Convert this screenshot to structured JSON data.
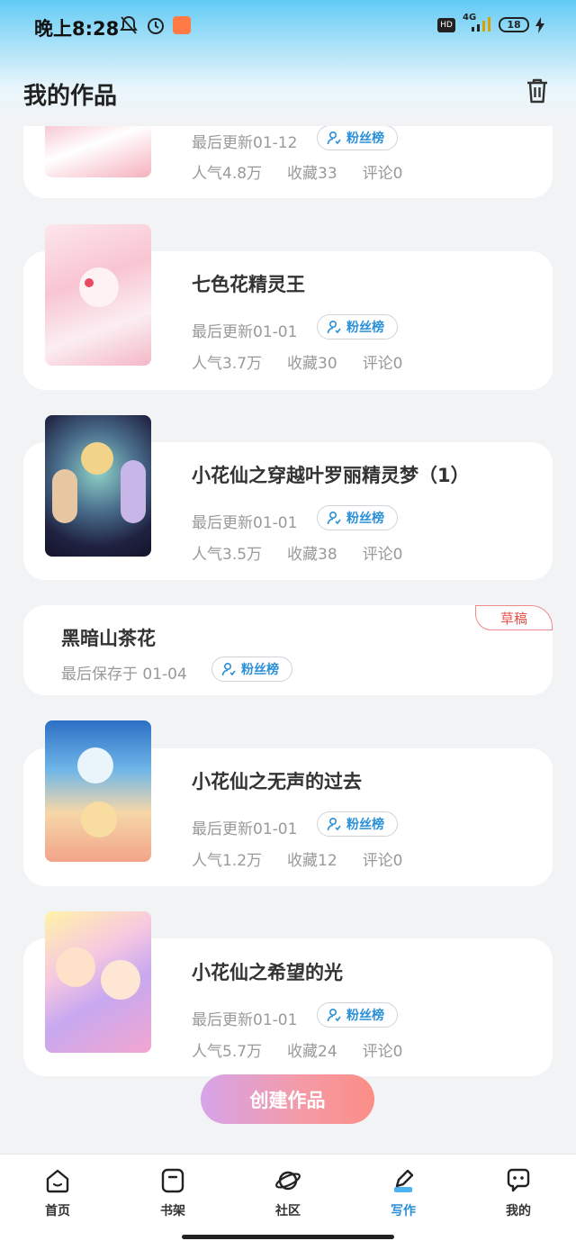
{
  "status_bar": {
    "time": "晚上8:28",
    "battery": "18",
    "network": "4G",
    "hd": "HD"
  },
  "header": {
    "title": "我的作品"
  },
  "works": [
    {
      "title": "",
      "updated": "最后更新01-12",
      "fans": "粉丝榜",
      "popularity": "人气4.8万",
      "favorites": "收藏33",
      "comments": "评论0"
    },
    {
      "title": "七色花精灵王",
      "updated": "最后更新01-01",
      "fans": "粉丝榜",
      "popularity": "人气3.7万",
      "favorites": "收藏30",
      "comments": "评论0"
    },
    {
      "title": "小花仙之穿越叶罗丽精灵梦（1）",
      "updated": "最后更新01-01",
      "fans": "粉丝榜",
      "popularity": "人气3.5万",
      "favorites": "收藏38",
      "comments": "评论0"
    },
    {
      "title": "小花仙之无声的过去",
      "updated": "最后更新01-01",
      "fans": "粉丝榜",
      "popularity": "人气1.2万",
      "favorites": "收藏12",
      "comments": "评论0"
    },
    {
      "title": "小花仙之希望的光",
      "updated": "最后更新01-01",
      "fans": "粉丝榜",
      "popularity": "人气5.7万",
      "favorites": "收藏24",
      "comments": "评论0"
    }
  ],
  "draft": {
    "title": "黑暗山茶花",
    "saved": "最后保存于 01-04",
    "fans": "粉丝榜",
    "badge": "草稿"
  },
  "create_button": "创建作品",
  "tabs": [
    {
      "label": "首页",
      "icon": "home-icon"
    },
    {
      "label": "书架",
      "icon": "bookshelf-icon"
    },
    {
      "label": "社区",
      "icon": "planet-icon"
    },
    {
      "label": "写作",
      "icon": "pen-icon",
      "active": true
    },
    {
      "label": "我的",
      "icon": "chat-bubble-icon"
    }
  ],
  "colors": {
    "accent": "#2a8fd9",
    "draft": "#e5534b",
    "header": "#63cbf5"
  }
}
